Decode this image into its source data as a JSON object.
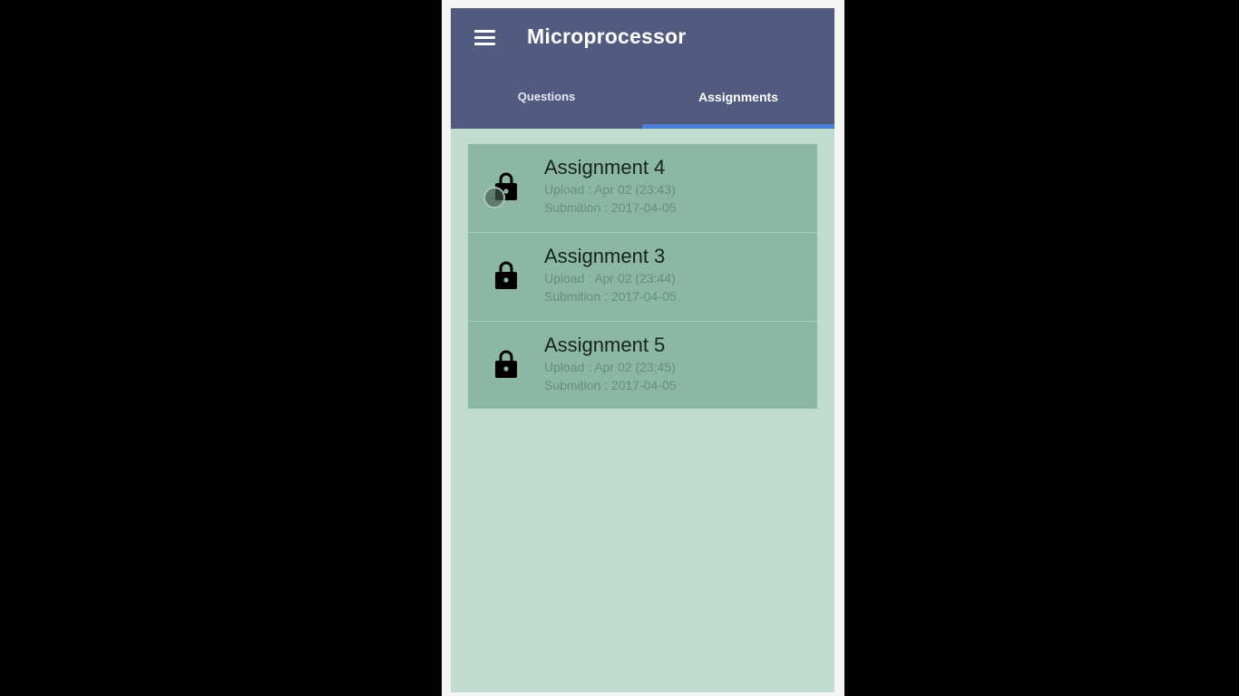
{
  "app": {
    "title": "Microprocessor"
  },
  "tabs": [
    {
      "label": "Questions",
      "selected": false
    },
    {
      "label": "Assignments",
      "selected": true
    }
  ],
  "colors": {
    "appbar": "#525b7f",
    "tab_indicator": "#4a7fd6",
    "list_background": "#8cb7a2",
    "screen_background": "#c0dccf"
  },
  "icons": {
    "menu": "hamburger-menu-icon",
    "item": "lock-icon"
  },
  "assignments": [
    {
      "title": "Assignment 4",
      "upload": "Upload : Apr 02 (23:43)",
      "submission": "Submition : 2017-04-05"
    },
    {
      "title": "Assignment 3",
      "upload": "Upload : Apr 02 (23:44)",
      "submission": "Submition : 2017-04-05"
    },
    {
      "title": "Assignment 5",
      "upload": "Upload : Apr 02 (23:45)",
      "submission": "Submition : 2017-04-05"
    }
  ]
}
